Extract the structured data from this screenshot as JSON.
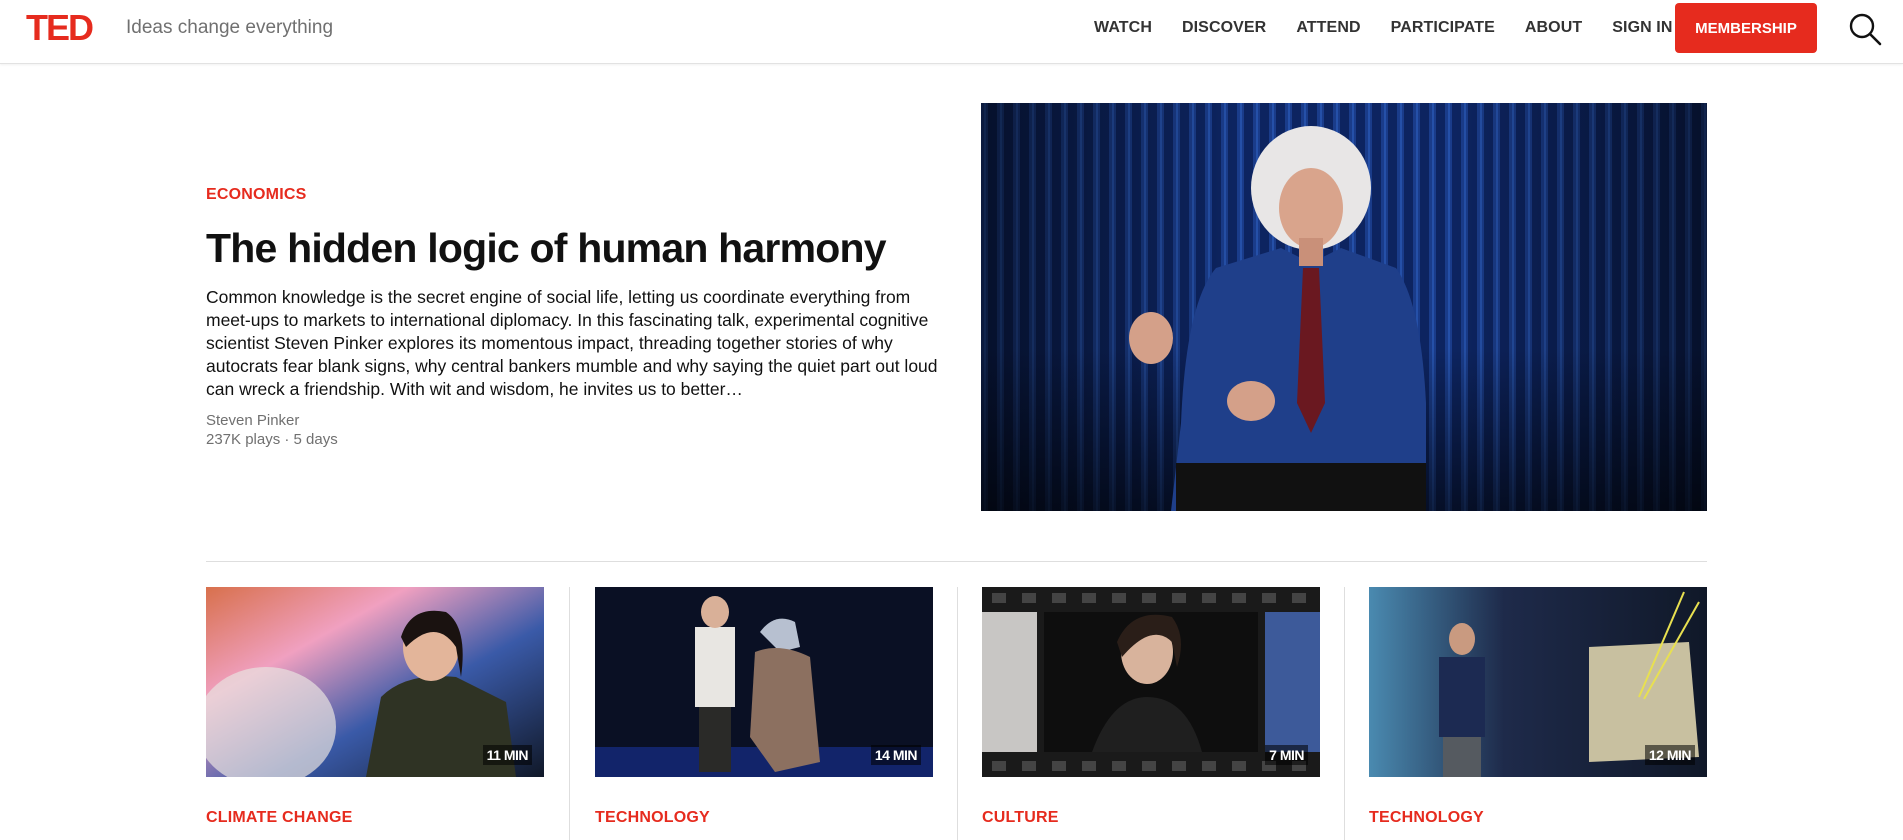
{
  "header": {
    "logo": "TED",
    "tagline": "Ideas change everything",
    "nav": [
      "WATCH",
      "DISCOVER",
      "ATTEND",
      "PARTICIPATE",
      "ABOUT",
      "SIGN IN"
    ],
    "membership_label": "MEMBERSHIP",
    "accent_color": "#e62b1e"
  },
  "hero": {
    "category": "ECONOMICS",
    "title": "The hidden logic of human harmony",
    "description": "Common knowledge is the secret engine of social life, letting us coordinate everything from meet-ups to markets to international diplomacy. In this fascinating talk, experimental cognitive scientist Steven Pinker explores its momentous impact, threading together stories of why autocrats fear blank signs, why central bankers mumble and why saying the quiet part out loud can wreck a friendship. With wit and wisdom, he invites us to better…",
    "speaker": "Steven Pinker",
    "meta": "237K plays · 5 days"
  },
  "cards": [
    {
      "duration": "11 MIN",
      "category": "CLIMATE CHANGE"
    },
    {
      "duration": "14 MIN",
      "category": "TECHNOLOGY"
    },
    {
      "duration": "7 MIN",
      "category": "CULTURE"
    },
    {
      "duration": "12 MIN",
      "category": "TECHNOLOGY"
    }
  ]
}
